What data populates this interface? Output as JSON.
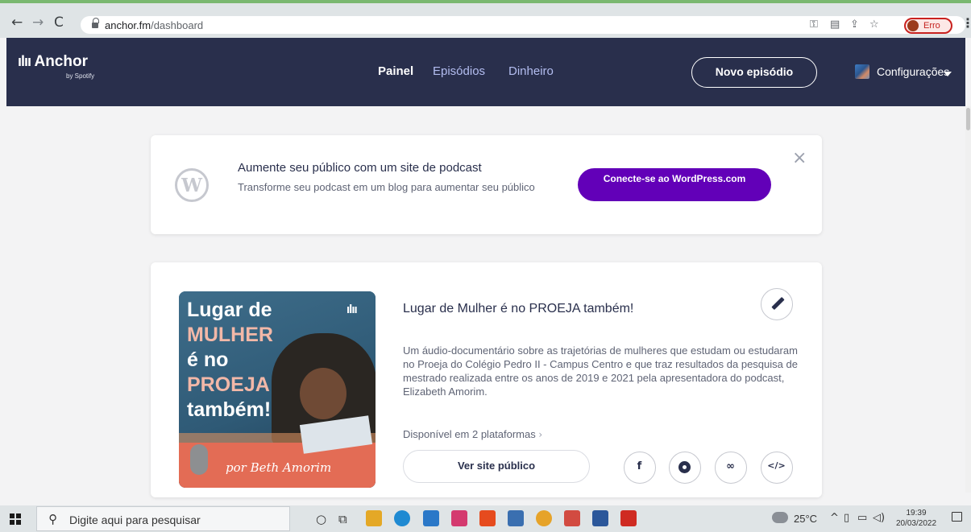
{
  "browser": {
    "url_host": "anchor.fm",
    "url_path": "/dashboard",
    "profile_label": "Erro"
  },
  "header": {
    "logo_name": "Anchor",
    "logo_by": "by Spotify",
    "nav": [
      "Painel",
      "Episódios",
      "Dinheiro"
    ],
    "new_episode": "Novo episódio",
    "settings": "Configurações"
  },
  "wordpress": {
    "logo_letter": "W",
    "title": "Aumente seu público com um site de podcast",
    "description": "Transforme seu podcast em um blog para aumentar seu público",
    "button": "Conecte-se ao WordPress.com",
    "close": "×"
  },
  "podcast": {
    "cover_line1": "Lugar de",
    "cover_line2": "MULHER",
    "cover_line3": "é no",
    "cover_line4": "PROEJA",
    "cover_line5": "também!",
    "cover_signature": "por Beth Amorim",
    "title": "Lugar de Mulher é no PROEJA também!",
    "description": "Um áudio-documentário sobre as trajetórias de mulheres que estudam ou estudaram no Proeja do Colégio Pedro II - Campus Centro e que traz resultados da pesquisa de mestrado realizada entre os anos de 2019 e 2021 pela apresentadora do podcast, Elizabeth Amorim.",
    "platforms": "Disponível em 2 plataformas",
    "public_site": "Ver site público"
  },
  "taskbar": {
    "search_placeholder": "Digite aqui para pesquisar",
    "temperature": "25°C",
    "time": "19:39",
    "date": "20/03/2022"
  },
  "colors": {
    "header_bg": "#292f4c",
    "primary_purple": "#6200b8",
    "text_dark": "#292f4c"
  }
}
